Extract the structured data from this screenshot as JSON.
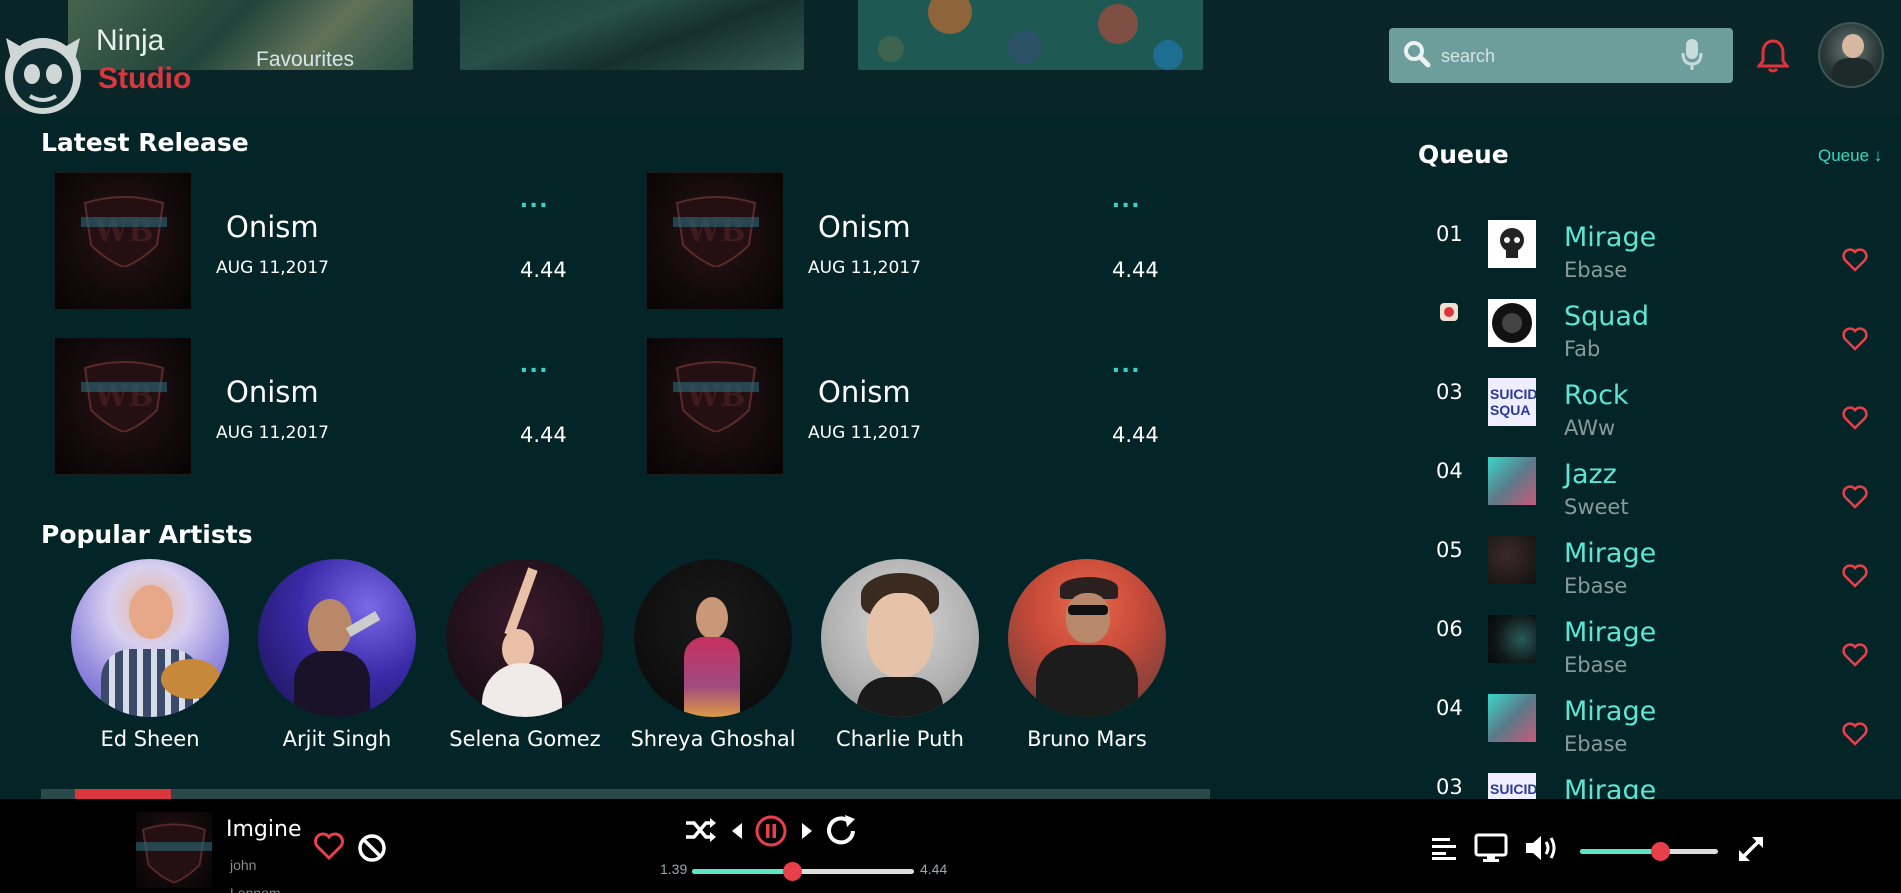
{
  "header": {
    "brand_top": "Ninja",
    "brand_bottom": "Studio",
    "favourites": "Favourites",
    "search_placeholder": "search"
  },
  "latest": {
    "title": "Latest Release",
    "items": [
      {
        "title": "Onism",
        "date": "AUG 11,2017",
        "more": "...",
        "duration": "4.44"
      },
      {
        "title": "Onism",
        "date": "AUG 11,2017",
        "more": "...",
        "duration": "4.44"
      },
      {
        "title": "Onism",
        "date": "AUG 11,2017",
        "more": "...",
        "duration": "4.44"
      },
      {
        "title": "Onism",
        "date": "AUG 11,2017",
        "more": "...",
        "duration": "4.44"
      }
    ]
  },
  "artists": {
    "title": "Popular Artists",
    "items": [
      {
        "name": "Ed Sheen"
      },
      {
        "name": "Arjit Singh"
      },
      {
        "name": "Selena Gomez"
      },
      {
        "name": "Shreya Ghoshal"
      },
      {
        "name": "Charlie Puth"
      },
      {
        "name": "Bruno Mars"
      }
    ]
  },
  "queue": {
    "title": "Queue",
    "link": "Queue",
    "items": [
      {
        "num": "01",
        "title": "Mirage",
        "artist": "Ebase"
      },
      {
        "num": "",
        "title": "Squad",
        "artist": "Fab"
      },
      {
        "num": "03",
        "title": "Rock",
        "artist": "AWw"
      },
      {
        "num": "04",
        "title": "Jazz",
        "artist": "Sweet"
      },
      {
        "num": "05",
        "title": "Mirage",
        "artist": "Ebase"
      },
      {
        "num": "06",
        "title": "Mirage",
        "artist": "Ebase"
      },
      {
        "num": "04",
        "title": "Mirage",
        "artist": "Ebase"
      },
      {
        "num": "03",
        "title": "Mirage",
        "artist": ""
      }
    ]
  },
  "player": {
    "title": "Imgine",
    "artist": "john Lennom",
    "elapsed": "1.39",
    "total": "4.44",
    "progress_fraction": 0.45,
    "volume_fraction": 0.58
  },
  "colors": {
    "accent": "#5de6d4",
    "brand_red": "#d9363e",
    "background": "#042528"
  }
}
